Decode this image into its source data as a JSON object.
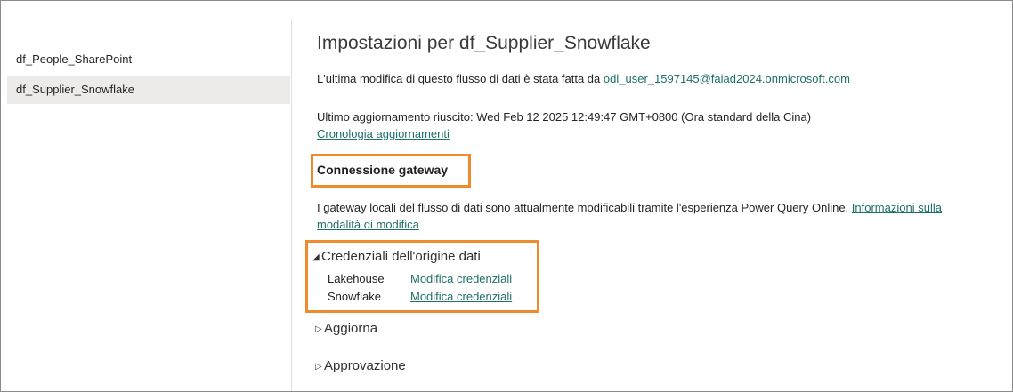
{
  "sidebar": {
    "items": [
      {
        "label": "df_People_SharePoint",
        "selected": false
      },
      {
        "label": "df_Supplier_Snowflake",
        "selected": true
      }
    ]
  },
  "main": {
    "title": "Impostazioni per df_Supplier_Snowflake",
    "last_modified_text": "L'ultima modifica di questo flusso di dati è stata fatta da",
    "last_modified_user": "odl_user_1597145@faiad2024.onmicrosoft.com",
    "last_refresh_text": "Ultimo aggiornamento riuscito: Wed Feb 12 2025 12:49:47 GMT+0800 (Ora standard della Cina)",
    "refresh_history_link": "Cronologia aggiornamenti",
    "gateway": {
      "heading": "Connessione gateway",
      "description": "I gateway locali del flusso di dati sono attualmente modificabili tramite l'esperienza Power Query Online.",
      "link_part1": "Informazioni sulla",
      "link_part2": "modalità di modifica"
    },
    "credentials": {
      "heading": "Credenziali dell'origine dati",
      "expanded": true,
      "items": [
        {
          "source": "Lakehouse",
          "action": "Modifica credenziali"
        },
        {
          "source": "Snowflake",
          "action": "Modifica credenziali"
        }
      ]
    },
    "refresh_section": {
      "heading": "Aggiorna",
      "expanded": false
    },
    "approval_section": {
      "heading": "Approvazione",
      "expanded": false
    }
  },
  "colors": {
    "link": "#1f6f6a",
    "highlight": "#ef8a2f",
    "selected_bg": "#edebe9"
  }
}
